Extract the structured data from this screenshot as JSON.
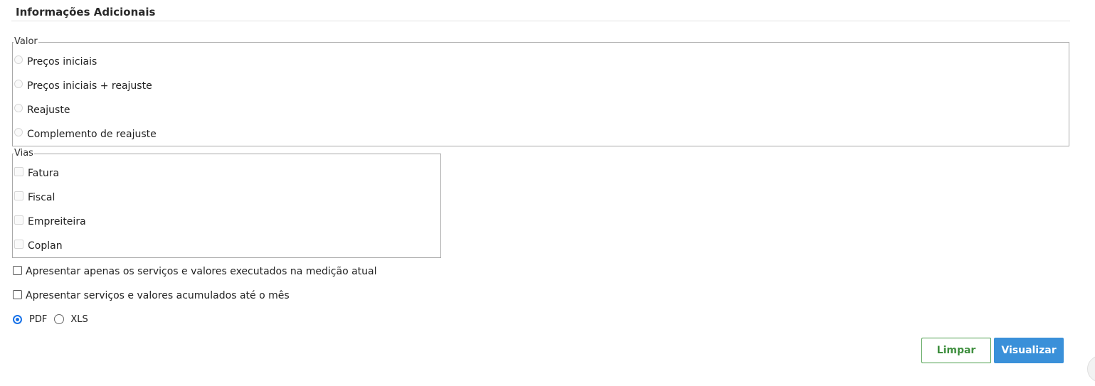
{
  "section": {
    "title": "Informações Adicionais"
  },
  "valor": {
    "legend": "Valor",
    "options": [
      {
        "label": "Preços iniciais",
        "selected": false,
        "enabled": false
      },
      {
        "label": "Preços iniciais + reajuste",
        "selected": false,
        "enabled": false
      },
      {
        "label": "Reajuste",
        "selected": false,
        "enabled": false
      },
      {
        "label": "Complemento de reajuste",
        "selected": false,
        "enabled": false
      }
    ]
  },
  "vias": {
    "legend": "Vias",
    "options": [
      {
        "label": "Fatura",
        "checked": false,
        "enabled": false
      },
      {
        "label": "Fiscal",
        "checked": false,
        "enabled": false
      },
      {
        "label": "Empreiteira",
        "checked": false,
        "enabled": false
      },
      {
        "label": "Coplan",
        "checked": false,
        "enabled": false
      }
    ]
  },
  "filters": {
    "apenas_medicao_atual": {
      "label": "Apresentar apenas os serviços e valores executados na medição atual",
      "checked": false
    },
    "acumulados_ate_mes": {
      "label": "Apresentar serviços e valores acumulados até o mês",
      "checked": false
    }
  },
  "format": {
    "selected": "PDF",
    "options": [
      "PDF",
      "XLS"
    ]
  },
  "buttons": {
    "clear_label": "Limpar",
    "view_label": "Visualizar"
  },
  "colors": {
    "accent_blue": "#3a90d9",
    "clear_green": "#3f8f3f"
  }
}
